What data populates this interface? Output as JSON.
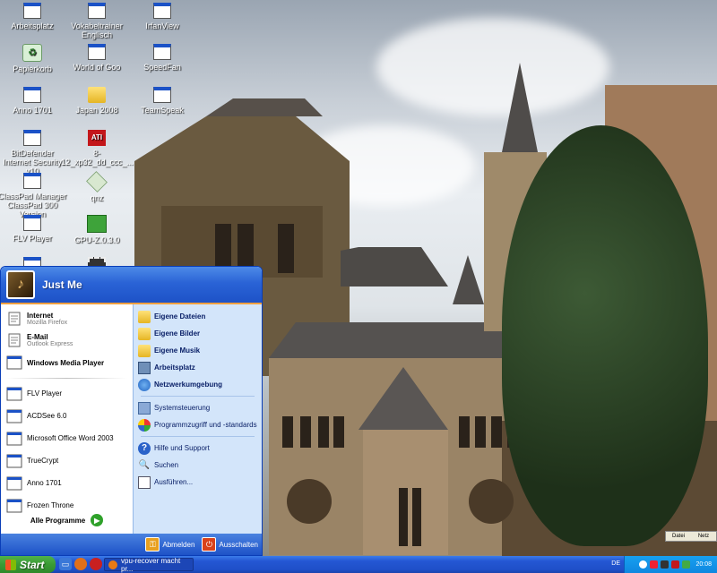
{
  "desktop": {
    "icons": [
      {
        "label": "Arbeitsplatz",
        "icon": "computer-shortcut-icon"
      },
      {
        "label": "Vokabeltrainer Englisch",
        "icon": "shortcut-icon"
      },
      {
        "label": "IrfanView",
        "icon": "shortcut-icon"
      },
      {
        "label": "Papierkorb",
        "icon": "recycle-bin-icon"
      },
      {
        "label": "World of Goo",
        "icon": "shortcut-icon"
      },
      {
        "label": "SpeedFan",
        "icon": "shortcut-icon"
      },
      {
        "label": "Anno 1701",
        "icon": "shortcut-icon"
      },
      {
        "label": "Japan 2008",
        "icon": "folder-icon"
      },
      {
        "label": "TeamSpeak",
        "icon": "shortcut-icon"
      },
      {
        "label": "BitDefender Internet Security v10",
        "icon": "shortcut-icon"
      },
      {
        "label": "8-12_xp32_dd_ccc_...",
        "icon": "ati-icon"
      },
      {
        "label": "ClassPad Manager ClassPad 300 Version",
        "icon": "shortcut-icon"
      },
      {
        "label": "qnz",
        "icon": "disk-icon"
      },
      {
        "label": "FLV Player",
        "icon": "shortcut-icon"
      },
      {
        "label": "GPU-Z.0.3.0",
        "icon": "gpu-icon"
      }
    ]
  },
  "start_menu": {
    "user_name": "Just Me",
    "pinned": [
      {
        "title": "Internet",
        "subtitle": "Mozilla Firefox"
      },
      {
        "title": "E-Mail",
        "subtitle": "Outlook Express"
      },
      {
        "title": "Windows Media Player",
        "subtitle": ""
      }
    ],
    "recent": [
      "FLV Player",
      "ACDSee 6.0",
      "Microsoft Office Word 2003",
      "TrueCrypt",
      "Anno 1701",
      "Frozen Throne"
    ],
    "all_programs_label": "Alle Programme",
    "right_items": [
      {
        "label": "Eigene Dateien",
        "bold": true
      },
      {
        "label": "Eigene Bilder",
        "bold": true
      },
      {
        "label": "Eigene Musik",
        "bold": true
      },
      {
        "label": "Arbeitsplatz",
        "bold": true
      },
      {
        "label": "Netzwerkumgebung",
        "bold": true
      },
      {
        "label": "Systemsteuerung",
        "bold": false
      },
      {
        "label": "Programmzugriff und -standards",
        "bold": false
      },
      {
        "label": "Hilfe und Support",
        "bold": false
      },
      {
        "label": "Suchen",
        "bold": false
      },
      {
        "label": "Ausführen...",
        "bold": false
      }
    ],
    "logoff_label": "Abmelden",
    "shutdown_label": "Ausschalten"
  },
  "mini_window": {
    "tab1": "Datei",
    "tab2": "Netz"
  },
  "taskbar": {
    "start_label": "Start",
    "task_label": "vpu-recover macht pr...",
    "language": "DE",
    "clock": "20:08"
  },
  "colors": {
    "taskbar_blue": "#245edb",
    "start_green": "#3a9b35",
    "menu_right_bg": "#d3e5fa"
  }
}
